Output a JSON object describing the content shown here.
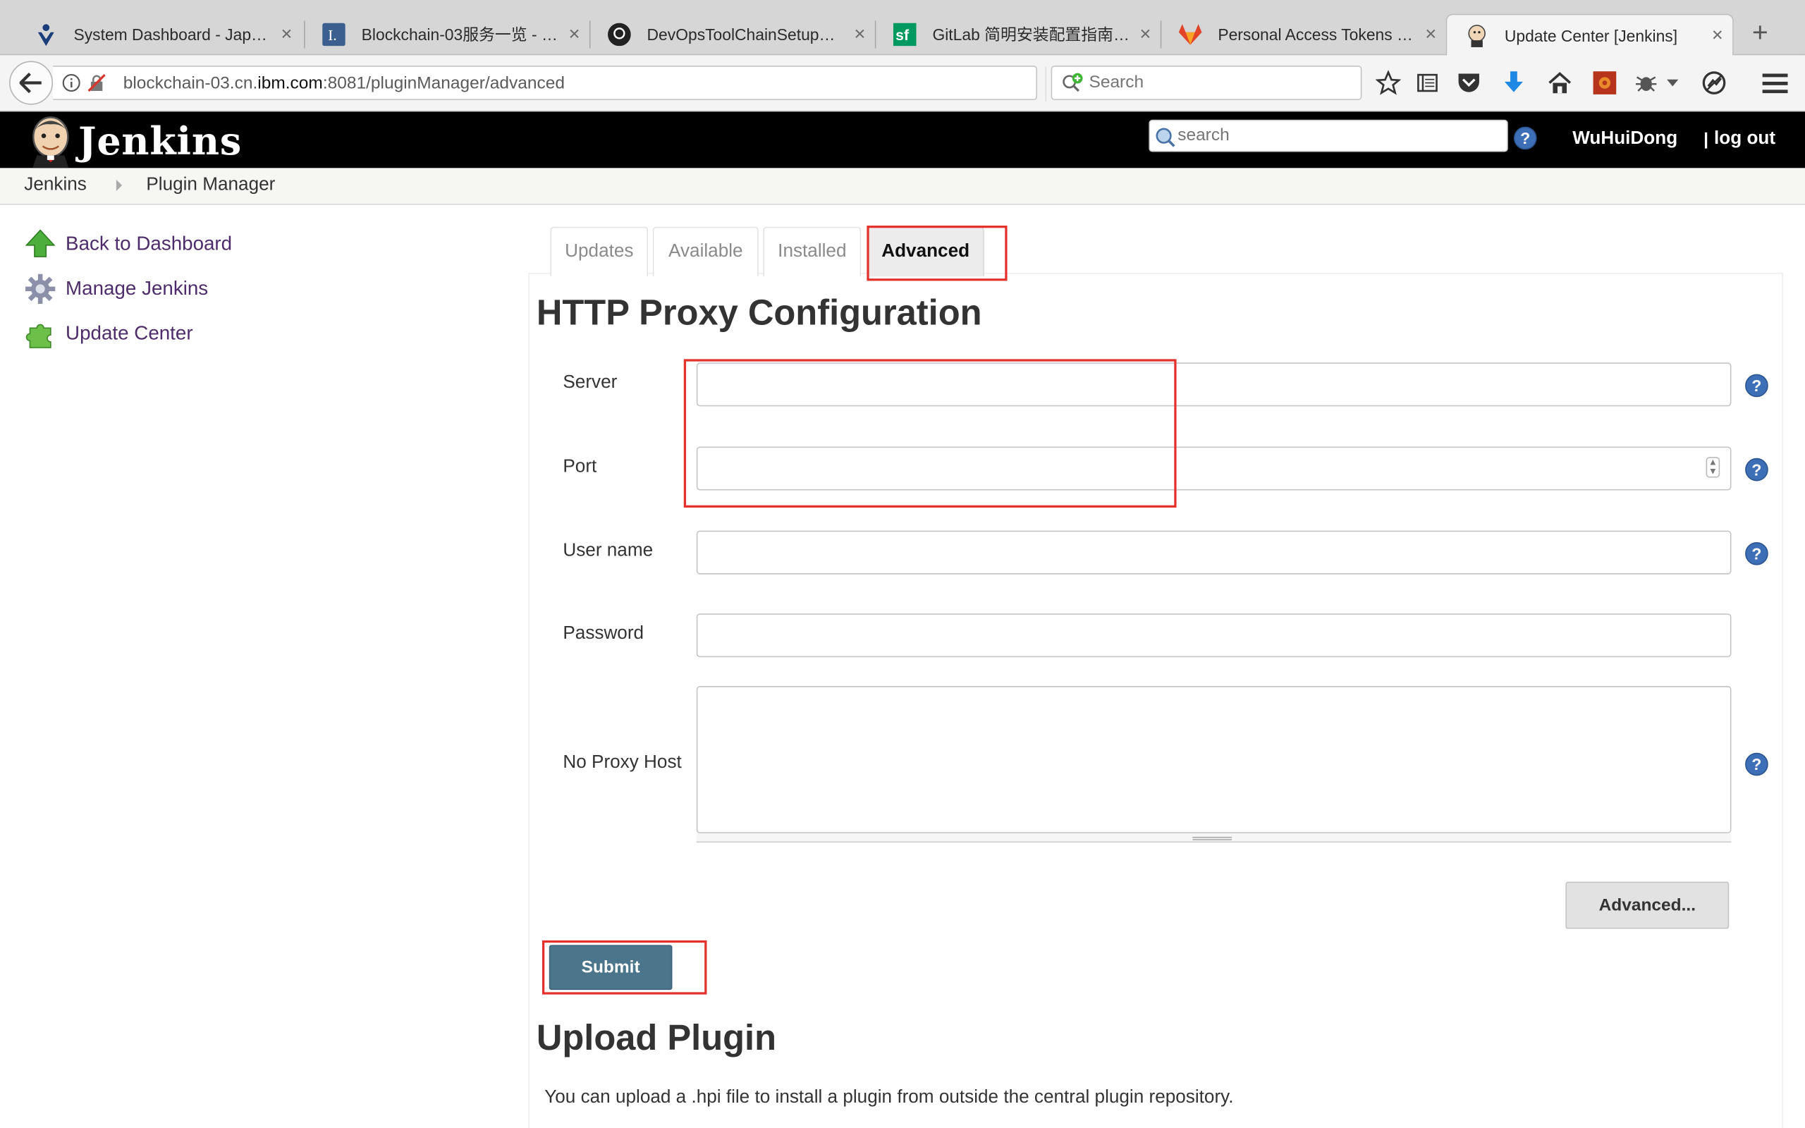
{
  "browser": {
    "tabs": [
      {
        "title": "System Dashboard - Japa…",
        "icon": "jira-icon"
      },
      {
        "title": "Blockchain-03服务一览 - …",
        "icon": "confluence-icon"
      },
      {
        "title": "DevOpsToolChainSetupG…",
        "icon": "github-icon"
      },
      {
        "title": "GitLab 简明安装配置指南 -…",
        "icon": "segmentfault-icon"
      },
      {
        "title": "Personal Access Tokens ·…",
        "icon": "gitlab-icon"
      },
      {
        "title": "Update Center [Jenkins]",
        "icon": "jenkins-icon",
        "active": true
      }
    ],
    "new_tab": "+",
    "url_prefix": "blockchain-03.cn.",
    "url_domain": "ibm.com",
    "url_suffix": ":8081/pluginManager/advanced",
    "search_placeholder": "Search"
  },
  "jenkins": {
    "logo": "Jenkins",
    "search_placeholder": "search",
    "help": "?",
    "user": "WuHuiDong",
    "logout": "log out"
  },
  "breadcrumb": [
    "Jenkins",
    "Plugin Manager"
  ],
  "sidebar": [
    {
      "label": "Back to Dashboard",
      "icon": "up-arrow-icon"
    },
    {
      "label": "Manage Jenkins",
      "icon": "gear-icon"
    },
    {
      "label": "Update Center",
      "icon": "puzzle-icon"
    }
  ],
  "plugin_tabs": [
    "Updates",
    "Available",
    "Installed",
    "Advanced"
  ],
  "active_tab": "Advanced",
  "proxy": {
    "heading": "HTTP Proxy Configuration",
    "server_label": "Server",
    "port_label": "Port",
    "username_label": "User name",
    "password_label": "Password",
    "noproxy_label": "No Proxy Host",
    "advanced_button": "Advanced...",
    "submit_button": "Submit"
  },
  "upload": {
    "heading": "Upload Plugin",
    "description": "You can upload a .hpi file to install a plugin from outside the central plugin repository."
  },
  "colors": {
    "jenkins_header": "#000000",
    "submit_bg": "#4b758b",
    "highlight_box": "#e4312b",
    "link": "#4e2c6a"
  }
}
